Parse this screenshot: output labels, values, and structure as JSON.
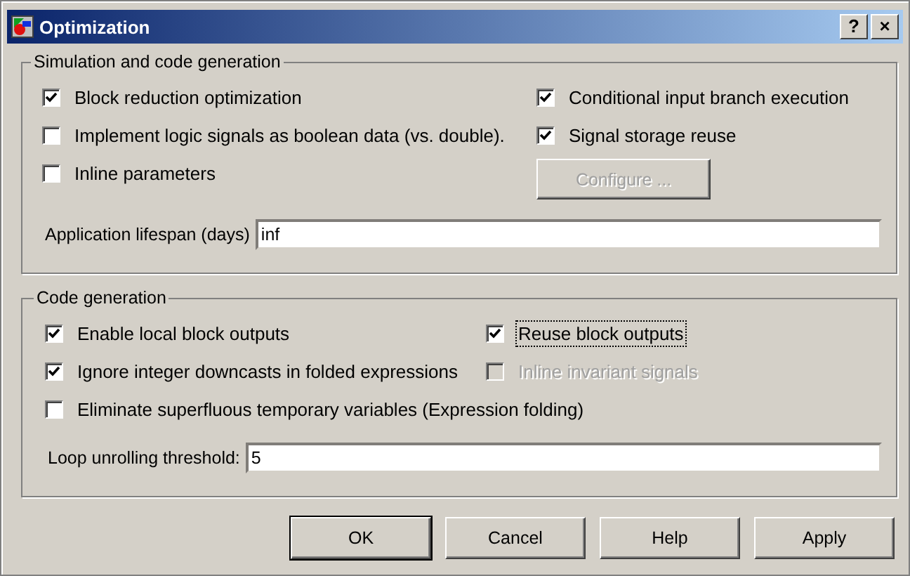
{
  "window": {
    "title": "Optimization",
    "title_buttons": [
      "?",
      "×"
    ]
  },
  "groups": [
    {
      "title": "Simulation and code generation",
      "options": [
        {
          "kind": "checkbox",
          "label": "Block reduction optimization",
          "checked": true,
          "disabled": false,
          "focused": false
        },
        {
          "kind": "checkbox",
          "label": "Conditional input branch execution",
          "checked": true,
          "disabled": false,
          "focused": false
        },
        {
          "kind": "checkbox",
          "label": "Implement logic signals as boolean data (vs. double).",
          "checked": false,
          "disabled": false,
          "focused": false
        },
        {
          "kind": "checkbox",
          "label": "Signal storage reuse",
          "checked": true,
          "disabled": false,
          "focused": false
        },
        {
          "kind": "checkbox",
          "label": "Inline parameters",
          "checked": false,
          "disabled": false,
          "focused": false
        },
        {
          "kind": "button",
          "label": "Configure ...",
          "disabled": true
        }
      ],
      "field": {
        "label": "Application lifespan (days)",
        "value": "inf"
      }
    },
    {
      "title": "Code generation",
      "options": [
        {
          "kind": "checkbox",
          "label": "Enable local block outputs",
          "checked": true,
          "disabled": false,
          "focused": false
        },
        {
          "kind": "checkbox",
          "label": "Reuse block outputs",
          "checked": true,
          "disabled": false,
          "focused": true
        },
        {
          "kind": "checkbox",
          "label": "Ignore integer downcasts in folded expressions",
          "checked": true,
          "disabled": false,
          "focused": false
        },
        {
          "kind": "checkbox",
          "label": "Inline invariant signals",
          "checked": false,
          "disabled": true,
          "focused": false
        },
        {
          "kind": "checkbox",
          "label": "Eliminate superfluous temporary variables (Expression folding)",
          "checked": false,
          "disabled": false,
          "focused": false
        }
      ],
      "field": {
        "label": "Loop unrolling threshold:",
        "value": "5"
      }
    }
  ],
  "buttons": [
    {
      "label": "OK",
      "default": true
    },
    {
      "label": "Cancel",
      "default": false
    },
    {
      "label": "Help",
      "default": false
    },
    {
      "label": "Apply",
      "default": false
    }
  ]
}
